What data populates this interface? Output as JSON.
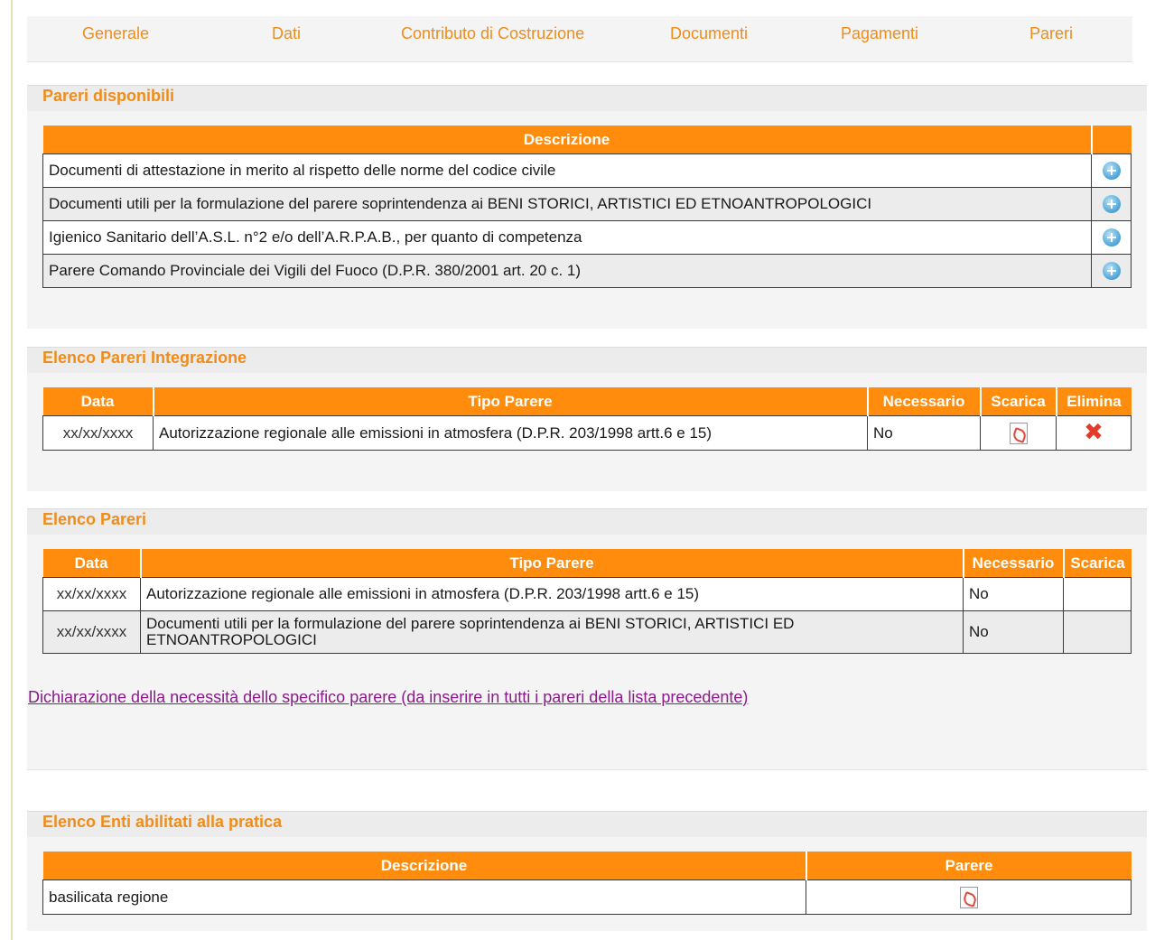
{
  "nav": {
    "tabs": [
      {
        "label": "Generale"
      },
      {
        "label": "Dati"
      },
      {
        "label": "Contributo di Costruzione"
      },
      {
        "label": "Documenti"
      },
      {
        "label": "Pagamenti"
      },
      {
        "label": "Pareri"
      }
    ]
  },
  "pareri_disponibili": {
    "title": "Pareri disponibili",
    "header": "Descrizione",
    "rows": [
      {
        "descrizione": "Documenti di attestazione in merito al rispetto delle norme del codice civile",
        "icon": "add-icon"
      },
      {
        "descrizione": "Documenti utili per la formulazione del parere soprintendenza ai BENI STORICI, ARTISTICI ED ETNOANTROPOLOGICI",
        "icon": "add-icon"
      },
      {
        "descrizione": "Igienico Sanitario dell’A.S.L. n°2 e/o dell’A.R.P.A.B., per quanto di competenza",
        "icon": "add-icon"
      },
      {
        "descrizione": "Parere Comando Provinciale dei Vigili del Fuoco (D.P.R. 380/2001 art. 20 c. 1)",
        "icon": "add-icon"
      }
    ]
  },
  "pareri_integrazione": {
    "title": "Elenco Pareri Integrazione",
    "headers": {
      "data": "Data",
      "tipo": "Tipo Parere",
      "necessario": "Necessario",
      "scarica": "Scarica",
      "elimina": "Elimina"
    },
    "rows": [
      {
        "data": "xx/xx/xxxx",
        "tipo": "Autorizzazione regionale alle emissioni in atmosfera (D.P.R. 203/1998 artt.6 e 15)",
        "necessario": "No",
        "scarica_icon": "pdf-icon",
        "elimina_icon": "delete-icon"
      }
    ]
  },
  "elenco_pareri": {
    "title": "Elenco Pareri",
    "headers": {
      "data": "Data",
      "tipo": "Tipo Parere",
      "necessario": "Necessario",
      "scarica": "Scarica"
    },
    "rows": [
      {
        "data": "xx/xx/xxxx",
        "tipo": "Autorizzazione regionale alle emissioni in atmosfera (D.P.R. 203/1998 artt.6 e 15)",
        "necessario": "No"
      },
      {
        "data": "xx/xx/xxxx",
        "tipo": "Documenti utili per la formulazione del parere soprintendenza ai BENI STORICI, ARTISTICI ED ETNOANTROPOLOGICI",
        "necessario": "No"
      }
    ],
    "link": "Dichiarazione della necessità dello specifico parere (da inserire in tutti i pareri della lista precedente)"
  },
  "enti": {
    "title": "Elenco Enti abilitati alla pratica",
    "headers": {
      "descrizione": "Descrizione",
      "parere": "Parere"
    },
    "rows": [
      {
        "descrizione": "basilicata regione",
        "parere_icon": "pdf-icon"
      }
    ]
  },
  "colors": {
    "accent": "#ff8c0c",
    "title_text": "#f08c1a",
    "link": "#8a1b8a",
    "delete": "#e23b2a",
    "panel_bg": "#f4f4f4"
  }
}
